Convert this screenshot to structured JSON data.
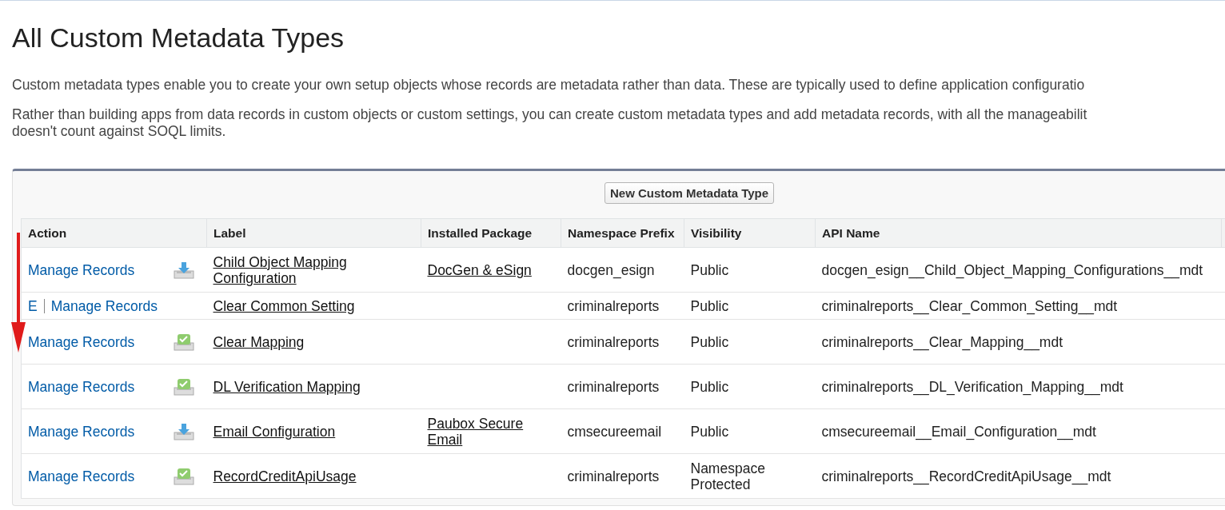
{
  "title": "All Custom Metadata Types",
  "paragraphs": [
    {
      "lines": [
        "Custom metadata types enable you to create your own setup objects whose records are metadata rather than data. These are typically used to define application configuratio"
      ]
    },
    {
      "lines": [
        "Rather than building apps from data records in custom objects or custom settings, you can create custom metadata types and add metadata records, with all the manageabilit",
        "doesn't count against SOQL limits."
      ]
    }
  ],
  "new_button": "New Custom Metadata Type",
  "table": {
    "columns": [
      "Action",
      "Label",
      "Installed Package",
      "Namespace Prefix",
      "Visibility",
      "API Name"
    ],
    "rows": [
      {
        "actions": [
          "Manage Records"
        ],
        "kind": "download",
        "label": "Child Object Mapping Configuration",
        "package": "DocGen & eSign",
        "prefix": "docgen_esign",
        "visibility": "Public",
        "api_name": "docgen_esign__Child_Object_Mapping_Configurations__mdt"
      },
      {
        "actions": [
          "E",
          "Manage Records"
        ],
        "label": "Clear Common Setting",
        "prefix": "criminalreports",
        "visibility": "Public",
        "api_name": "criminalreports__Clear_Common_Setting__mdt"
      },
      {
        "actions": [
          "Manage Records"
        ],
        "kind": "check",
        "label": "Clear Mapping",
        "prefix": "criminalreports",
        "visibility": "Public",
        "api_name": "criminalreports__Clear_Mapping__mdt"
      },
      {
        "actions": [
          "Manage Records"
        ],
        "kind": "check",
        "label": "DL Verification Mapping",
        "prefix": "criminalreports",
        "visibility": "Public",
        "api_name": "criminalreports__DL_Verification_Mapping__mdt"
      },
      {
        "actions": [
          "Manage Records"
        ],
        "kind": "download",
        "label": "Email Configuration",
        "package": "Paubox Secure Email",
        "prefix": "cmsecureemail",
        "visibility": "Public",
        "api_name": "cmsecureemail__Email_Configuration__mdt"
      },
      {
        "actions": [
          "Manage Records"
        ],
        "kind": "check",
        "label": "RecordCreditApiUsage",
        "prefix": "criminalreports",
        "visibility": "Namespace Protected",
        "api_name": "criminalreports__RecordCreditApiUsage__mdt"
      }
    ]
  }
}
